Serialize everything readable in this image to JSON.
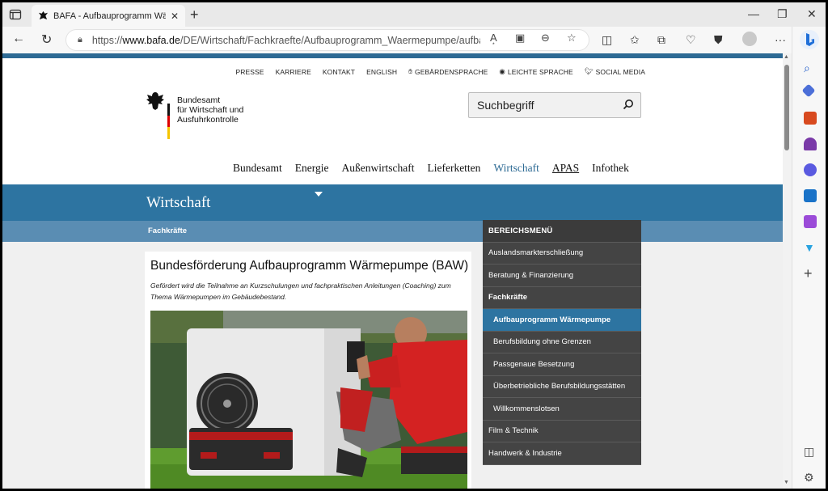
{
  "browser": {
    "tab_title": "BAFA - Aufbauprogramm Wärmepumpe",
    "url_prefix": "https://",
    "url_host": "www.bafa.de",
    "url_path": "/DE/Wirtschaft/Fachkraefte/Aufbauprogramm_Waermepumpe/aufbauprog..."
  },
  "utility_nav": [
    "PRESSE",
    "KARRIERE",
    "KONTAKT",
    "ENGLISH",
    "GEBÄRDENSPRACHE",
    "LEICHTE SPRACHE",
    "SOCIAL MEDIA"
  ],
  "logo": {
    "line1": "Bundesamt",
    "line2": "für Wirtschaft und",
    "line3": "Ausfuhrkontrolle"
  },
  "search": {
    "placeholder": "Suchbegriff"
  },
  "main_nav": [
    "Bundesamt",
    "Energie",
    "Außenwirtschaft",
    "Lieferketten",
    "Wirtschaft",
    "APAS",
    "Infothek"
  ],
  "band": {
    "title": "Wirtschaft"
  },
  "breadcrumb": "Fachkräfte",
  "article": {
    "title": "Bundesförderung Aufbauprogramm Wärmepumpe (BAW)",
    "lead": "Gefördert wird die Teilnahme an Kurzschulungen und fachpraktischen Anleitungen (Coaching) zum Thema Wärmepumpen im Gebäudebestand."
  },
  "side_menu": {
    "header": "BEREICHSMENÜ",
    "items": [
      "Auslandsmarkterschließung",
      "Beratung & Finanzierung",
      "Fachkräfte",
      "Aufbauprogramm Wärmepumpe",
      "Berufsbildung ohne Grenzen",
      "Passgenaue Besetzung",
      "Überbetriebliche Berufsbildungsstätten",
      "Willkommenslotsen",
      "Film & Technik",
      "Handwerk & Industrie"
    ]
  },
  "colors": {
    "primary_blue": "#2d74a1",
    "sub_band_blue": "#5a8db3",
    "menu_dark": "#444444",
    "active_nav": "#2d6a94"
  }
}
